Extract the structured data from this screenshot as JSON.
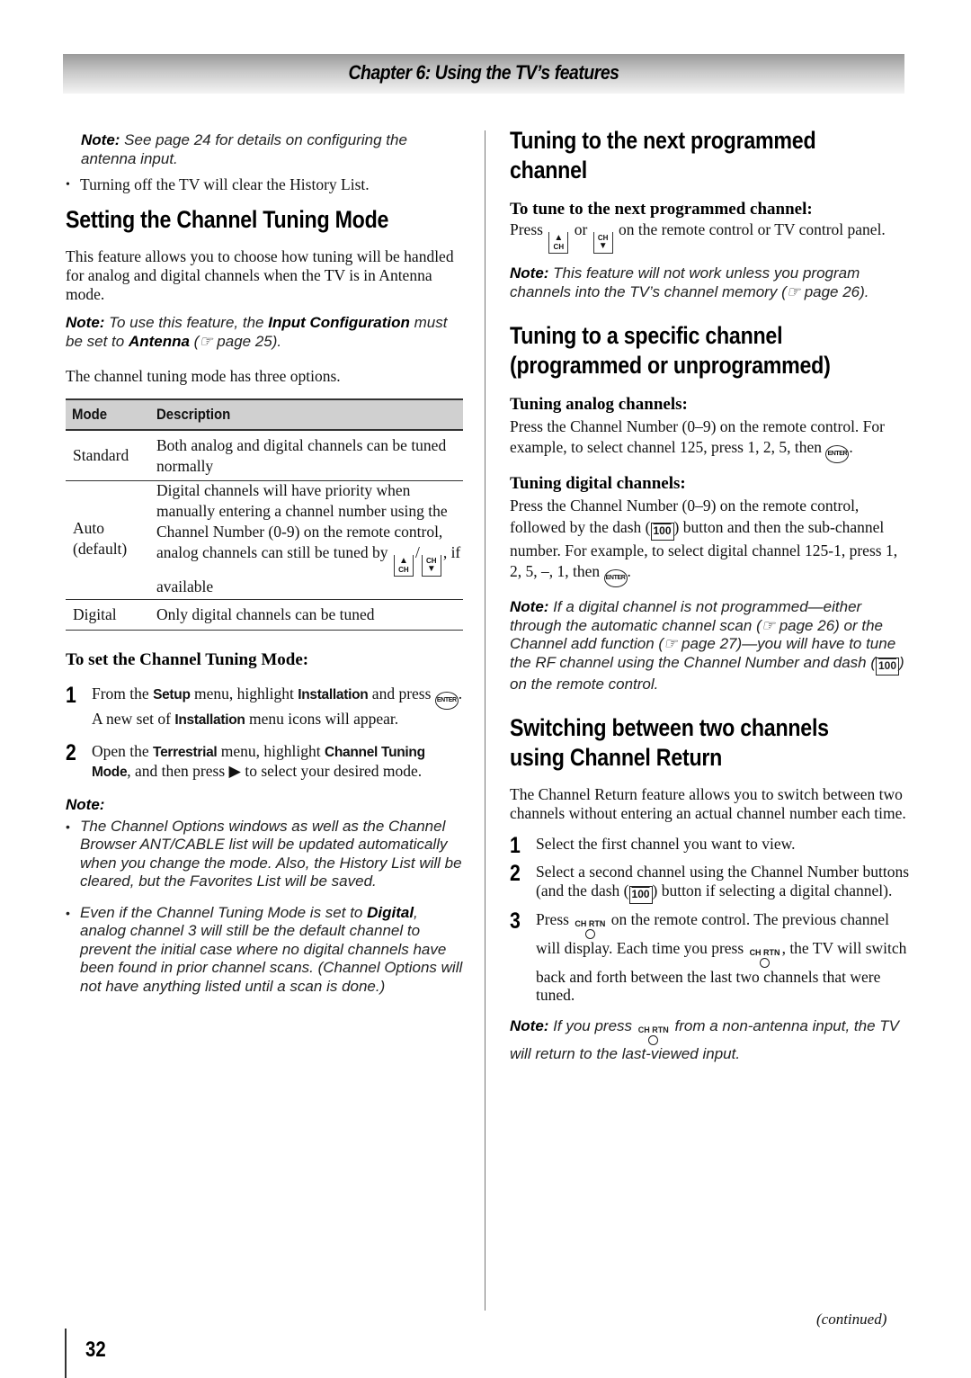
{
  "chapter_header": {
    "title": "Chapter 6: Using the TV’s features"
  },
  "left": {
    "note_top": {
      "label": "Note:",
      "text": " See page 24 for details on configuring the antenna input."
    },
    "bullet_history": "Turning off the TV will clear the History List.",
    "section_title": "Setting the Channel Tuning Mode",
    "intro": "This feature allows you to choose how tuning will be handled for analog and digital channels when the TV is in Antenna mode.",
    "note_input": {
      "label": "Note:",
      "pre": " To use this feature, the ",
      "bold1": "Input Configuration",
      "mid": " must be set to ",
      "bold2": "Antenna",
      "ref": " (☞ page 25)."
    },
    "options_line": "The channel tuning mode has three options.",
    "table": {
      "headers": [
        "Mode",
        "Description"
      ],
      "rows": [
        {
          "mode": "Standard",
          "description": "Both analog and digital channels can be tuned normally"
        },
        {
          "mode": "Auto (default)",
          "description": "Digital channels will have priority when manually entering a channel number using the Channel Number (0-9) on the remote control, analog channels can still be tuned by",
          "description_suffix": ", if available"
        },
        {
          "mode": "Digital",
          "description": "Only digital channels can be tuned"
        }
      ]
    },
    "procedure_title": "To set the Channel Tuning Mode:",
    "steps": [
      {
        "num": "1",
        "p1": "From the ",
        "b1": "Setup",
        "p2": " menu, highlight ",
        "b2": "Installation",
        "p3": " and press ",
        "p4": ". A new set of ",
        "b3": "Installation",
        "p5": " menu icons will appear."
      },
      {
        "num": "2",
        "p1": "Open the ",
        "b1": "Terrestrial",
        "p2": " menu, highlight ",
        "b2": "Channel Tuning Mode",
        "p3": ", and then press ▶ to select your desired mode."
      }
    ],
    "note_block": {
      "label": "Note:",
      "bullet1": "The Channel Options windows as well as the Channel Browser ANT/CABLE list will be updated automatically when you change the mode. Also, the History List will be cleared, but the Favorites List will be saved.",
      "bullet2_pre": "Even if the Channel Tuning Mode is set to ",
      "bullet2_bold": "Digital",
      "bullet2_post": ", analog channel 3 will still be the default channel to prevent the initial case where no digital channels have been found in prior channel scans. (Channel Options will not have anything listed until a scan is done.)"
    }
  },
  "right": {
    "section1_title": "Tuning to the next programmed channel",
    "section1_sub": "To tune to the next programmed channel:",
    "section1_body": {
      "pre": "Press ",
      "mid": " or ",
      "post": " on the remote control or TV control panel."
    },
    "section1_note": {
      "label": "Note:",
      "text": " This feature will not work unless you program channels into the TV’s channel memory (☞ page 26)."
    },
    "section2_title": "Tuning to a specific channel (programmed or unprogrammed)",
    "analog": {
      "title": "Tuning analog channels:",
      "text": "Press the Channel Number (0–9) on the remote control. For example, to select channel 125, press 1, 2, 5, then ",
      "end": "."
    },
    "digital": {
      "title": "Tuning digital channels:",
      "pre": "Press the Channel Number (0–9) on the remote control, followed by the dash (",
      "mid": ") button and then the sub-channel number. For example, to select digital channel 125-1, press 1, 2, 5, –, 1, then ",
      "end": "."
    },
    "digital_note": {
      "label": "Note:",
      "pre": " If a digital channel is not programmed—either through the automatic channel scan (☞ page 26) or the Channel add function (☞ page 27)—you will have to tune the RF channel using the Channel Number and dash (",
      "post": ") on the remote control."
    },
    "section3_title": "Switching between two channels using Channel Return",
    "section3_intro": "The Channel Return feature allows you to switch between two channels without entering an actual channel number each time.",
    "steps": [
      {
        "num": "1",
        "text": "Select the first channel you want to view."
      },
      {
        "num": "2",
        "pre": "Select a second channel using the Channel Number buttons (and the dash (",
        "post": ") button if selecting a digital channel)."
      },
      {
        "num": "3",
        "pre": "Press ",
        "mid": " on the remote control. The previous channel will display. Each time you press ",
        "post": ", the TV will switch back and forth between the last two channels that were tuned."
      }
    ],
    "final_note": {
      "label": "Note:",
      "pre": " If you press ",
      "post": " from a non-antenna input, the TV will return to the last-viewed input."
    }
  },
  "icons": {
    "ch_up": {
      "arrow": "▲",
      "label": "CH"
    },
    "ch_down": {
      "arrow": "▼",
      "label": "CH"
    },
    "enter": "ENTER",
    "dash": "100",
    "ch_rtn": "CH RTN"
  },
  "footer": {
    "continued": "(continued)",
    "page_number": "32"
  }
}
